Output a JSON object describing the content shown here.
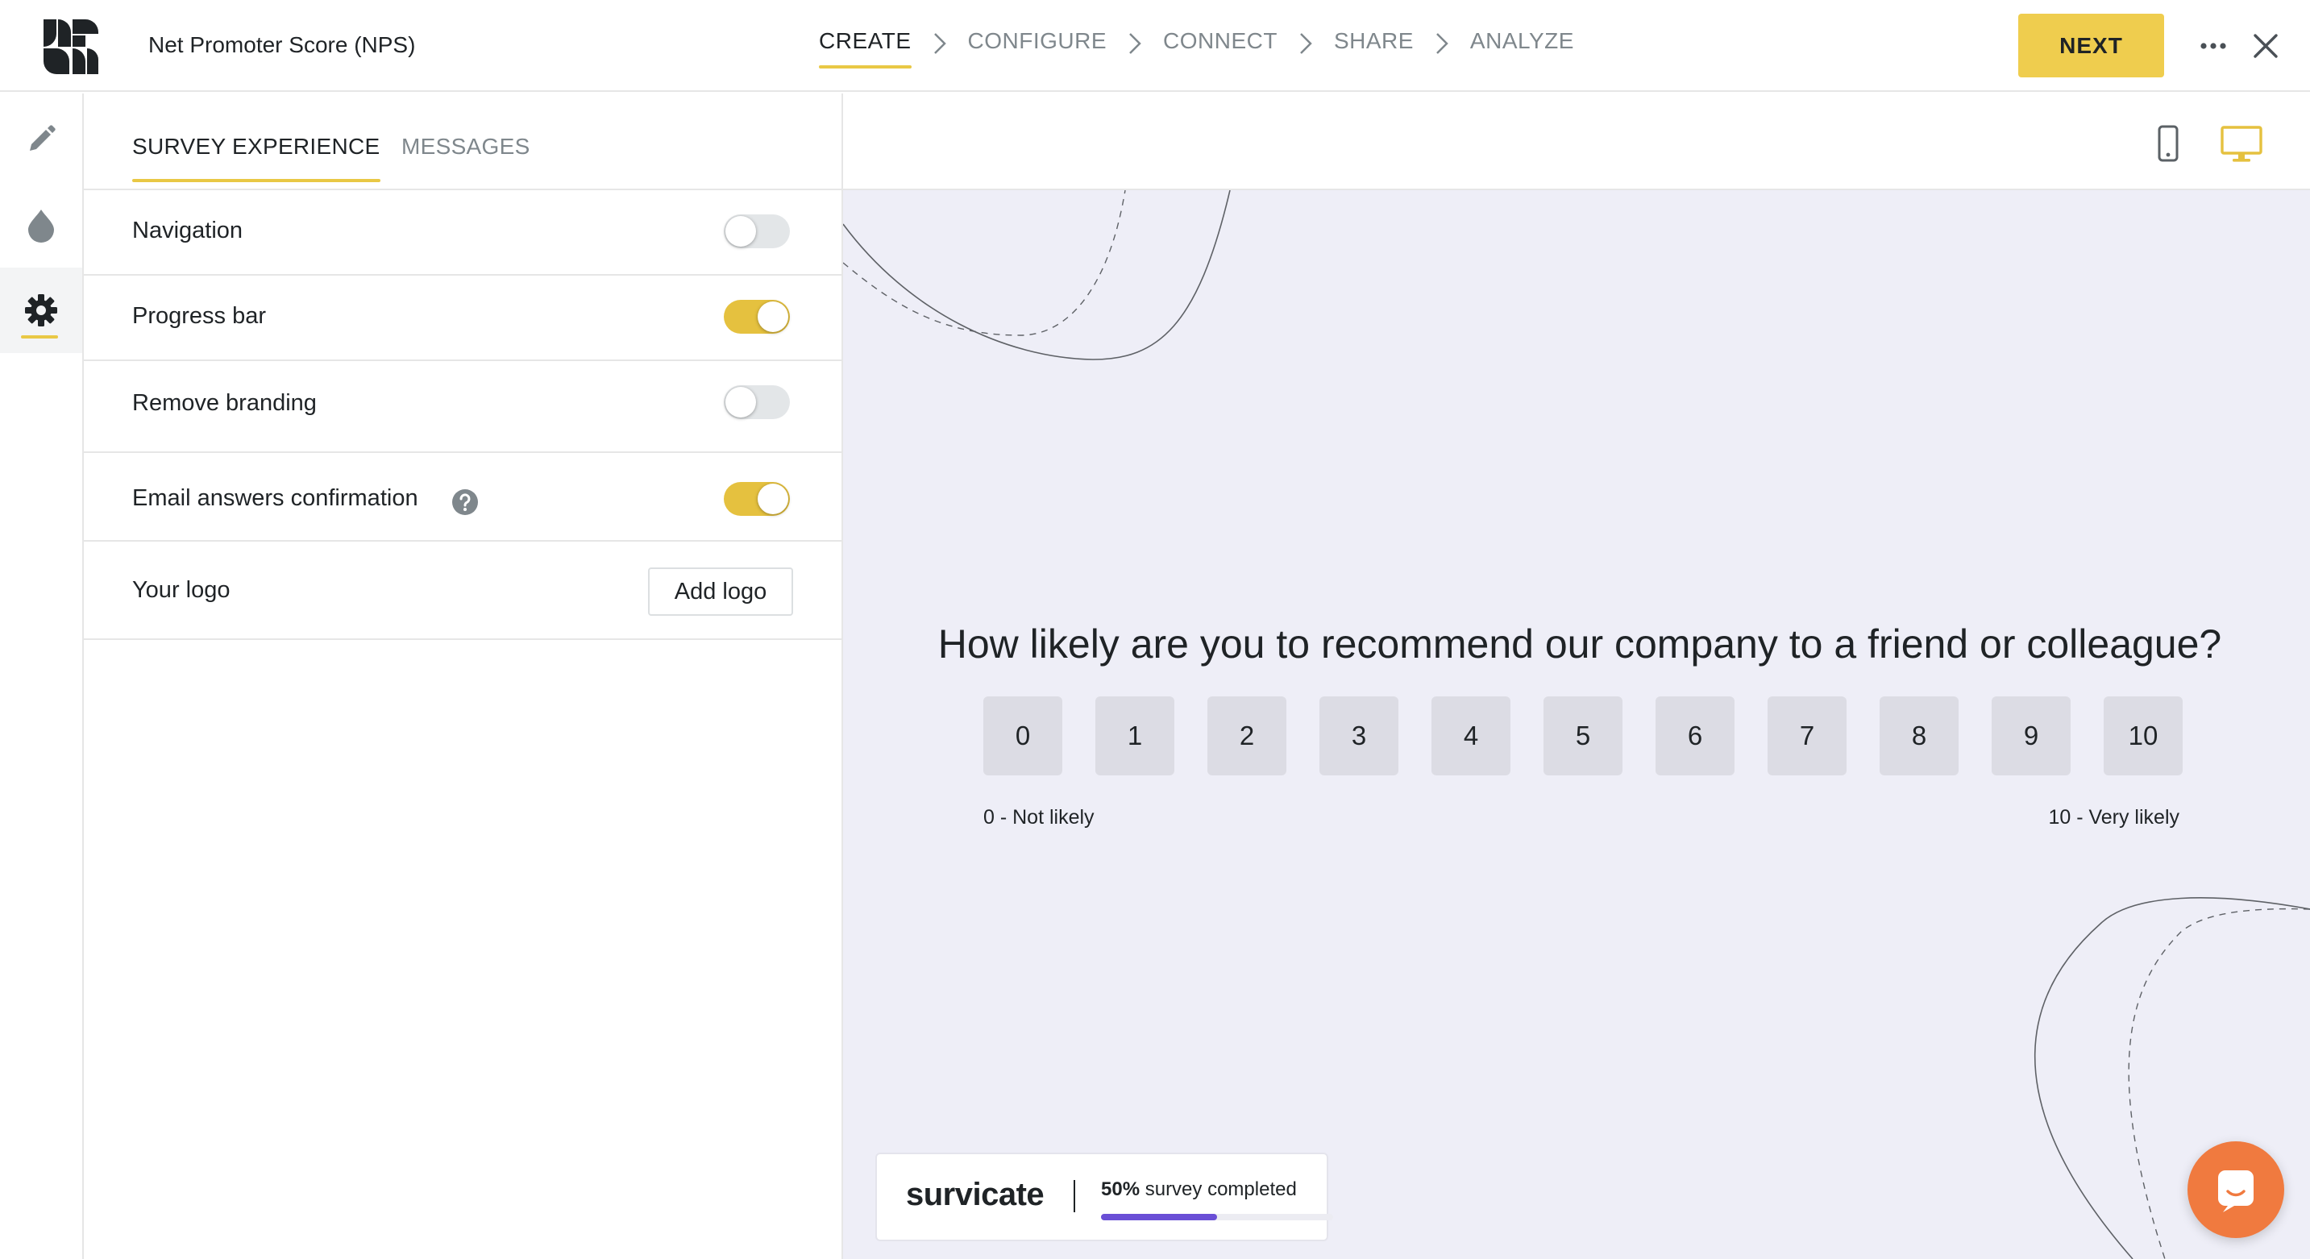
{
  "header": {
    "survey_title": "Net Promoter Score (NPS)",
    "steps": [
      {
        "label": "CREATE",
        "active": true
      },
      {
        "label": "CONFIGURE",
        "active": false
      },
      {
        "label": "CONNECT",
        "active": false
      },
      {
        "label": "SHARE",
        "active": false
      },
      {
        "label": "ANALYZE",
        "active": false
      }
    ],
    "next_label": "NEXT",
    "icons": {
      "logo": "survicate-logo",
      "more": "more-horizontal-icon",
      "close": "close-icon"
    }
  },
  "rail": {
    "items": [
      {
        "name": "edit-pencil-icon",
        "active": false
      },
      {
        "name": "theme-drop-icon",
        "active": false
      },
      {
        "name": "settings-gear-icon",
        "active": true
      }
    ]
  },
  "panel": {
    "tabs": [
      {
        "label": "SURVEY EXPERIENCE",
        "active": true
      },
      {
        "label": "MESSAGES",
        "active": false
      }
    ],
    "settings": [
      {
        "label": "Navigation",
        "enabled": false
      },
      {
        "label": "Progress bar",
        "enabled": true
      },
      {
        "label": "Remove branding",
        "enabled": false
      },
      {
        "label": "Email answers confirmation",
        "enabled": true,
        "help_icon": "question-circle-icon"
      }
    ],
    "logo_row": {
      "label": "Your logo",
      "button_label": "Add logo"
    }
  },
  "preview": {
    "devices": [
      {
        "name": "mobile-device-icon",
        "active": false
      },
      {
        "name": "desktop-device-icon",
        "active": true
      }
    ],
    "question": "How likely are you to recommend our company to a friend or colleague?",
    "scale": [
      "0",
      "1",
      "2",
      "3",
      "4",
      "5",
      "6",
      "7",
      "8",
      "9",
      "10"
    ],
    "scale_min_label": "0 - Not likely",
    "scale_max_label": "10 - Very likely",
    "branding": {
      "brand_name": "survicate",
      "progress_percent_text": "50%",
      "progress_suffix": " survey completed",
      "progress_value": 0.5
    },
    "chat_icon": "chat-launcher-icon"
  },
  "colors": {
    "accent": "#efcd4e",
    "toggle_on": "#e5c13f",
    "canvas_bg": "#eeeef7",
    "progress_fill": "#6a4fd6",
    "chat_launcher": "#f07a3f",
    "desktop_icon_active": "#e5c13f"
  }
}
